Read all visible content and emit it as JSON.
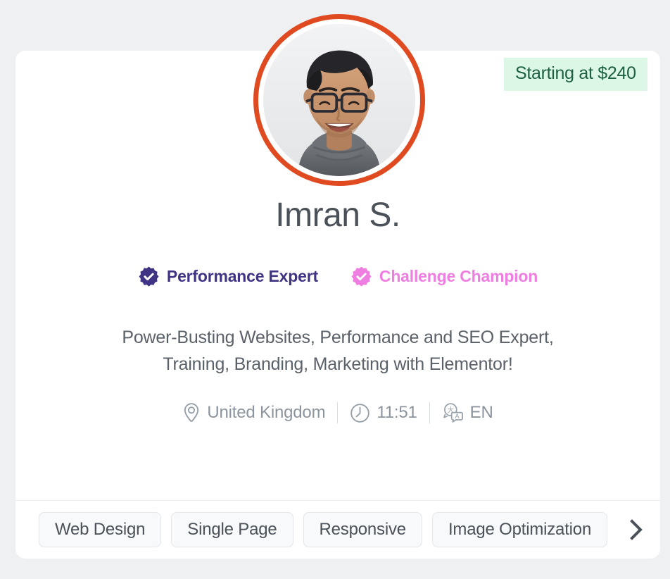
{
  "page": {
    "background_color": "#eef0f2"
  },
  "card": {
    "background_color": "#ffffff"
  },
  "price_badge": {
    "label": "Starting at $240",
    "background_color": "#ddf7e6",
    "text_color": "#1d6140"
  },
  "avatar": {
    "icon": "profile-photo",
    "ring_color": "#e04a20",
    "alt": "Imran S. profile photo"
  },
  "profile": {
    "name": "Imran S.",
    "tagline_line1": "Power-Busting Websites, Performance and SEO Expert,",
    "tagline_line2": "Training, Branding, Marketing with Elementor!"
  },
  "badges": [
    {
      "label": "Performance Expert",
      "icon": "verified-badge-icon",
      "color": "#3f3484"
    },
    {
      "label": "Challenge Champion",
      "icon": "verified-badge-icon",
      "color": "#ee7ee0"
    }
  ],
  "meta": {
    "location": {
      "icon": "location-pin-icon",
      "value": "United Kingdom"
    },
    "time": {
      "icon": "clock-icon",
      "value": "11:51"
    },
    "language": {
      "icon": "translate-icon",
      "value": "EN"
    }
  },
  "tags": {
    "items": [
      {
        "label": "Web Design"
      },
      {
        "label": "Single Page"
      },
      {
        "label": "Responsive"
      },
      {
        "label": "Image Optimization"
      }
    ],
    "next_icon": "chevron-right-icon"
  }
}
